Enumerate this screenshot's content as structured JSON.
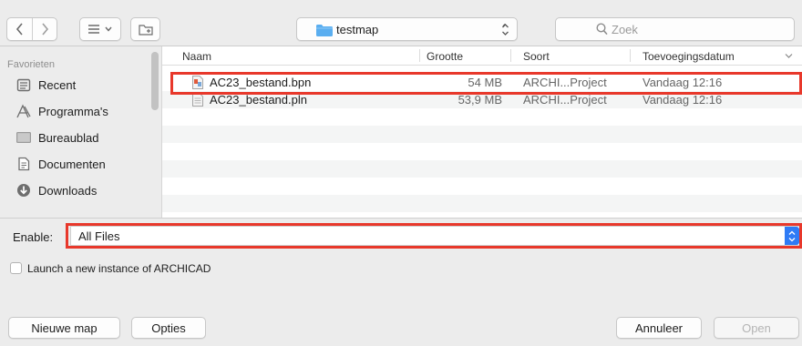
{
  "window": {
    "path_popup": {
      "label": "testmap"
    },
    "search": {
      "placeholder": "Zoek"
    }
  },
  "sidebar": {
    "heading": "Favorieten",
    "items": [
      {
        "label": "Recent",
        "icon": "recent-icon"
      },
      {
        "label": "Programma's",
        "icon": "applications-icon"
      },
      {
        "label": "Bureaublad",
        "icon": "desktop-icon"
      },
      {
        "label": "Documenten",
        "icon": "documents-icon"
      },
      {
        "label": "Downloads",
        "icon": "downloads-icon"
      }
    ]
  },
  "filelist": {
    "columns": {
      "name": "Naam",
      "size": "Grootte",
      "kind": "Soort",
      "date": "Toevoegingsdatum"
    },
    "rows": [
      {
        "name": "AC23_bestand.bpn",
        "size": "54 MB",
        "kind": "ARCHI...Project",
        "date": "Vandaag 12:16",
        "highlighted": true
      },
      {
        "name": "AC23_bestand.pln",
        "size": "53,9 MB",
        "kind": "ARCHI...Project",
        "date": "Vandaag 12:16",
        "highlighted": false
      }
    ]
  },
  "options": {
    "enable_label": "Enable:",
    "enable_value": "All Files",
    "launch_checkbox_label": "Launch a new instance of ARCHICAD",
    "launch_checked": false
  },
  "footer": {
    "new_folder": "Nieuwe map",
    "options": "Opties",
    "cancel": "Annuleer",
    "open": "Open"
  },
  "colors": {
    "highlight": "#e8382b",
    "accent": "#2f7bf5",
    "folder": "#5aaef0"
  }
}
